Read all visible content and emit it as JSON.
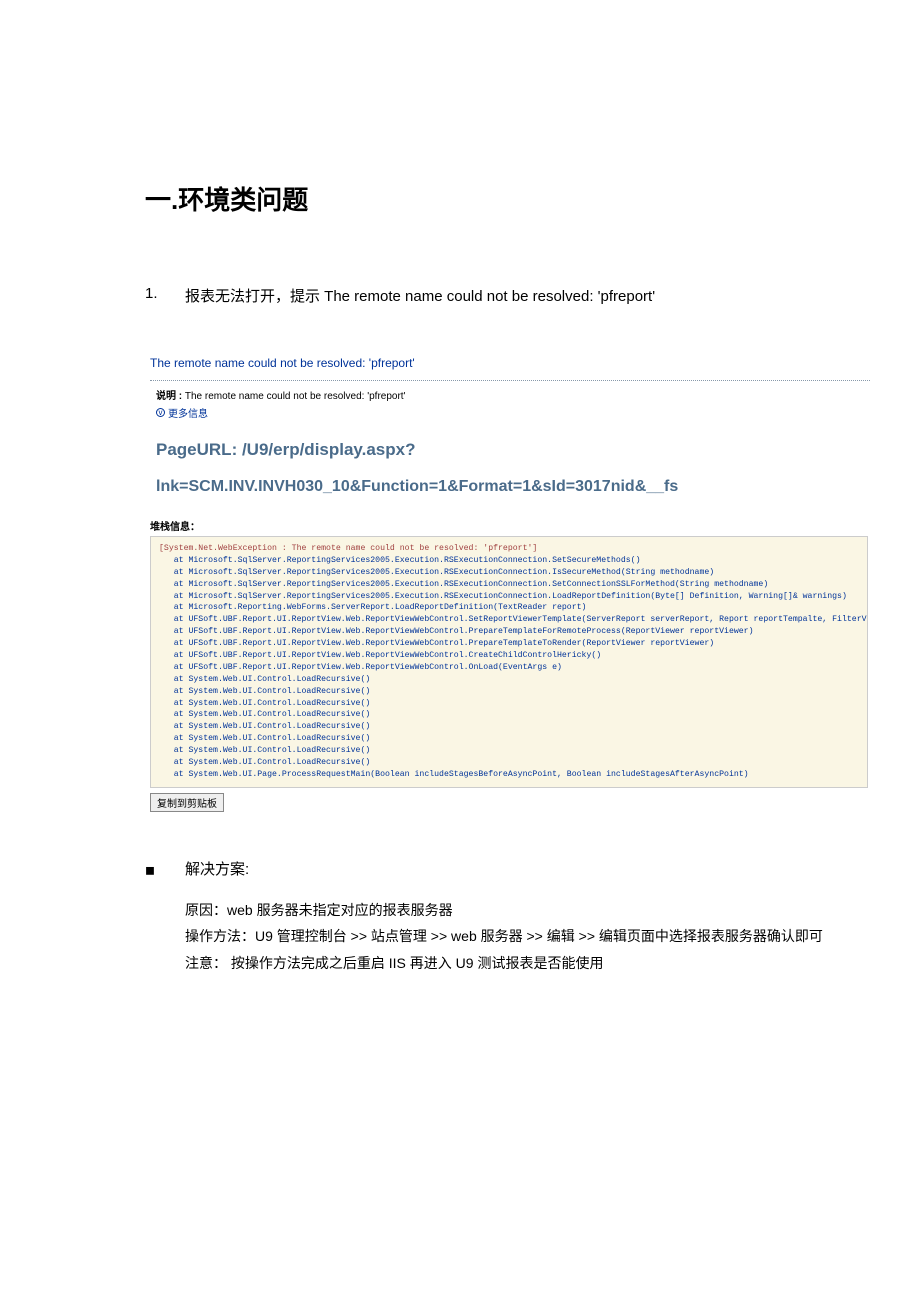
{
  "doc": {
    "heading": "一.环境类问题",
    "item_num": "1.",
    "item_text": "报表无法打开，提示 The remote name could not be resolved: 'pfreport'",
    "solution_label": "解决方案:",
    "line_reason": "原因：web 服务器未指定对应的报表服务器",
    "line_method": "操作方法：U9 管理控制台 >> 站点管理 >> web 服务器 >> 编辑 >> 编辑页面中选择报表服务器确认即可",
    "line_note": "注意： 按操作方法完成之后重启 IIS 再进入 U9 测试报表是否能使用"
  },
  "screenshot": {
    "error_name": "The remote name could not be resolved: 'pfreport'",
    "desc_label": "说明 :",
    "desc_text": " The remote name could not be resolved: 'pfreport'",
    "more_info": "更多信息",
    "page_url_label": "PageURL: /U9/erp/display.aspx?",
    "lnk_line": "lnk=SCM.INV.INVH030_10&Function=1&Format=1&sId=3017nid&__fs",
    "stack_label": "堆栈信息：",
    "stack_top": "[System.Net.WebException : The remote name could not be resolved: 'pfreport']",
    "stack_body": "   at Microsoft.SqlServer.ReportingServices2005.Execution.RSExecutionConnection.SetSecureMethods()\n   at Microsoft.SqlServer.ReportingServices2005.Execution.RSExecutionConnection.IsSecureMethod(String methodname)\n   at Microsoft.SqlServer.ReportingServices2005.Execution.RSExecutionConnection.SetConnectionSSLForMethod(String methodname)\n   at Microsoft.SqlServer.ReportingServices2005.Execution.RSExecutionConnection.LoadReportDefinition(Byte[] Definition, Warning[]& warnings)\n   at Microsoft.Reporting.WebForms.ServerReport.LoadReportDefinition(TextReader report)\n   at UFSoft.UBF.Report.UI.ReportView.Web.ReportViewWebControl.SetReportViewerTemplate(ServerReport serverReport, Report reportTempalte, FilterValues filterValues)\n   at UFSoft.UBF.Report.UI.ReportView.Web.ReportViewWebControl.PrepareTemplateForRemoteProcess(ReportViewer reportViewer)\n   at UFSoft.UBF.Report.UI.ReportView.Web.ReportViewWebControl.PrepareTemplateToRender(ReportViewer reportViewer)\n   at UFSoft.UBF.Report.UI.ReportView.Web.ReportViewWebControl.CreateChildControlHericky()\n   at UFSoft.UBF.Report.UI.ReportView.Web.ReportViewWebControl.OnLoad(EventArgs e)\n   at System.Web.UI.Control.LoadRecursive()\n   at System.Web.UI.Control.LoadRecursive()\n   at System.Web.UI.Control.LoadRecursive()\n   at System.Web.UI.Control.LoadRecursive()\n   at System.Web.UI.Control.LoadRecursive()\n   at System.Web.UI.Control.LoadRecursive()\n   at System.Web.UI.Control.LoadRecursive()\n   at System.Web.UI.Control.LoadRecursive()\n   at System.Web.UI.Page.ProcessRequestMain(Boolean includeStagesBeforeAsyncPoint, Boolean includeStagesAfterAsyncPoint)",
    "button_label": "复制到剪贴板"
  }
}
